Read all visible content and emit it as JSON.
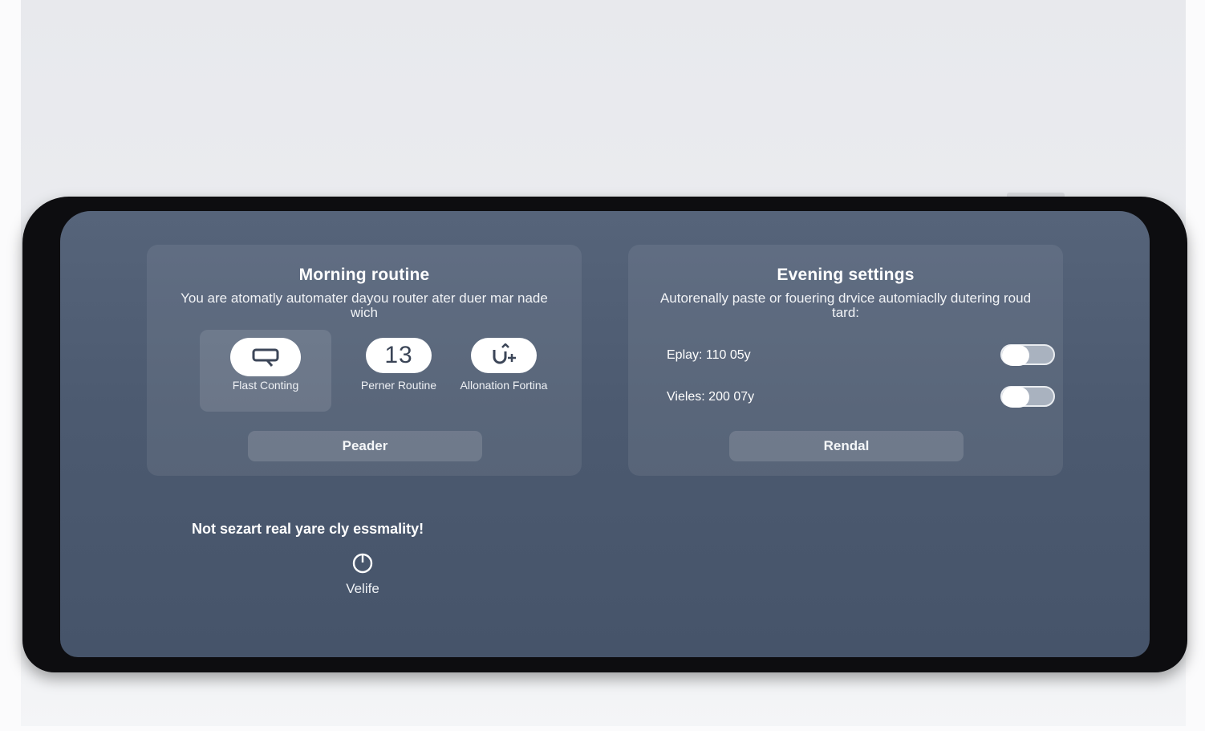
{
  "morning": {
    "title": "Morning routine",
    "description": "You are atomatly automater dayou router ater duer mar nade wich",
    "items": [
      {
        "label": "Flast Conting",
        "icon": "chat-bubble-icon",
        "selected": true
      },
      {
        "label": "Perner Routine",
        "icon_text": "13"
      },
      {
        "label": "Allonation Fortina",
        "icon": "loop-plus-icon"
      }
    ],
    "button": "Peader"
  },
  "evening": {
    "title": "Evening settings",
    "description": "Autorenally paste or fouering drvice automiaclly dutering roud tard:",
    "settings": [
      {
        "label": "Eplay: 110 05y",
        "enabled": true
      },
      {
        "label": "Vieles: 200 07y",
        "enabled": true
      }
    ],
    "button": "Rendal"
  },
  "notice": "Not sezart real yare cly essmality!",
  "power": {
    "label": "Velife",
    "icon": "power-icon"
  },
  "colors": {
    "screen": "#4c5a70",
    "bezel": "#0d0d10",
    "card": "#5b687d",
    "text": "#ffffff"
  }
}
